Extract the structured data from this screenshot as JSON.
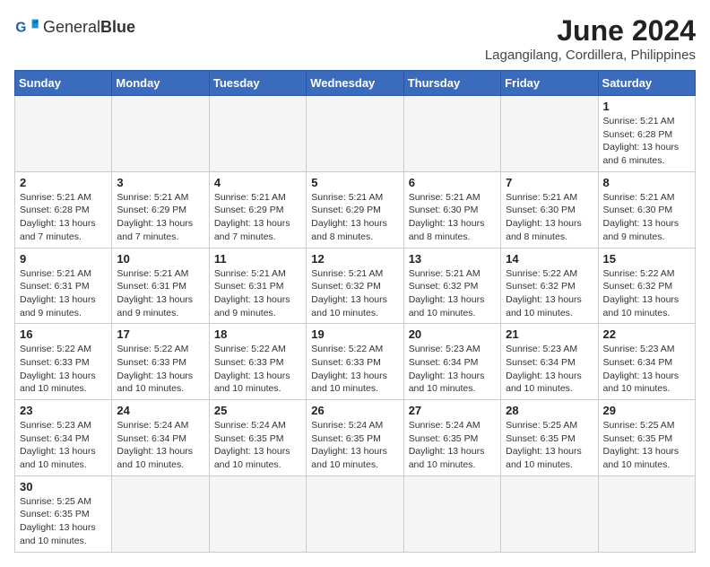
{
  "header": {
    "logo_text_normal": "General",
    "logo_text_bold": "Blue",
    "month_year": "June 2024",
    "location": "Lagangilang, Cordillera, Philippines"
  },
  "weekdays": [
    "Sunday",
    "Monday",
    "Tuesday",
    "Wednesday",
    "Thursday",
    "Friday",
    "Saturday"
  ],
  "weeks": [
    [
      {
        "day": "",
        "info": ""
      },
      {
        "day": "",
        "info": ""
      },
      {
        "day": "",
        "info": ""
      },
      {
        "day": "",
        "info": ""
      },
      {
        "day": "",
        "info": ""
      },
      {
        "day": "",
        "info": ""
      },
      {
        "day": "1",
        "info": "Sunrise: 5:21 AM\nSunset: 6:28 PM\nDaylight: 13 hours and 6 minutes."
      }
    ],
    [
      {
        "day": "2",
        "info": "Sunrise: 5:21 AM\nSunset: 6:28 PM\nDaylight: 13 hours and 7 minutes."
      },
      {
        "day": "3",
        "info": "Sunrise: 5:21 AM\nSunset: 6:29 PM\nDaylight: 13 hours and 7 minutes."
      },
      {
        "day": "4",
        "info": "Sunrise: 5:21 AM\nSunset: 6:29 PM\nDaylight: 13 hours and 7 minutes."
      },
      {
        "day": "5",
        "info": "Sunrise: 5:21 AM\nSunset: 6:29 PM\nDaylight: 13 hours and 8 minutes."
      },
      {
        "day": "6",
        "info": "Sunrise: 5:21 AM\nSunset: 6:30 PM\nDaylight: 13 hours and 8 minutes."
      },
      {
        "day": "7",
        "info": "Sunrise: 5:21 AM\nSunset: 6:30 PM\nDaylight: 13 hours and 8 minutes."
      },
      {
        "day": "8",
        "info": "Sunrise: 5:21 AM\nSunset: 6:30 PM\nDaylight: 13 hours and 9 minutes."
      }
    ],
    [
      {
        "day": "9",
        "info": "Sunrise: 5:21 AM\nSunset: 6:31 PM\nDaylight: 13 hours and 9 minutes."
      },
      {
        "day": "10",
        "info": "Sunrise: 5:21 AM\nSunset: 6:31 PM\nDaylight: 13 hours and 9 minutes."
      },
      {
        "day": "11",
        "info": "Sunrise: 5:21 AM\nSunset: 6:31 PM\nDaylight: 13 hours and 9 minutes."
      },
      {
        "day": "12",
        "info": "Sunrise: 5:21 AM\nSunset: 6:32 PM\nDaylight: 13 hours and 10 minutes."
      },
      {
        "day": "13",
        "info": "Sunrise: 5:21 AM\nSunset: 6:32 PM\nDaylight: 13 hours and 10 minutes."
      },
      {
        "day": "14",
        "info": "Sunrise: 5:22 AM\nSunset: 6:32 PM\nDaylight: 13 hours and 10 minutes."
      },
      {
        "day": "15",
        "info": "Sunrise: 5:22 AM\nSunset: 6:32 PM\nDaylight: 13 hours and 10 minutes."
      }
    ],
    [
      {
        "day": "16",
        "info": "Sunrise: 5:22 AM\nSunset: 6:33 PM\nDaylight: 13 hours and 10 minutes."
      },
      {
        "day": "17",
        "info": "Sunrise: 5:22 AM\nSunset: 6:33 PM\nDaylight: 13 hours and 10 minutes."
      },
      {
        "day": "18",
        "info": "Sunrise: 5:22 AM\nSunset: 6:33 PM\nDaylight: 13 hours and 10 minutes."
      },
      {
        "day": "19",
        "info": "Sunrise: 5:22 AM\nSunset: 6:33 PM\nDaylight: 13 hours and 10 minutes."
      },
      {
        "day": "20",
        "info": "Sunrise: 5:23 AM\nSunset: 6:34 PM\nDaylight: 13 hours and 10 minutes."
      },
      {
        "day": "21",
        "info": "Sunrise: 5:23 AM\nSunset: 6:34 PM\nDaylight: 13 hours and 10 minutes."
      },
      {
        "day": "22",
        "info": "Sunrise: 5:23 AM\nSunset: 6:34 PM\nDaylight: 13 hours and 10 minutes."
      }
    ],
    [
      {
        "day": "23",
        "info": "Sunrise: 5:23 AM\nSunset: 6:34 PM\nDaylight: 13 hours and 10 minutes."
      },
      {
        "day": "24",
        "info": "Sunrise: 5:24 AM\nSunset: 6:34 PM\nDaylight: 13 hours and 10 minutes."
      },
      {
        "day": "25",
        "info": "Sunrise: 5:24 AM\nSunset: 6:35 PM\nDaylight: 13 hours and 10 minutes."
      },
      {
        "day": "26",
        "info": "Sunrise: 5:24 AM\nSunset: 6:35 PM\nDaylight: 13 hours and 10 minutes."
      },
      {
        "day": "27",
        "info": "Sunrise: 5:24 AM\nSunset: 6:35 PM\nDaylight: 13 hours and 10 minutes."
      },
      {
        "day": "28",
        "info": "Sunrise: 5:25 AM\nSunset: 6:35 PM\nDaylight: 13 hours and 10 minutes."
      },
      {
        "day": "29",
        "info": "Sunrise: 5:25 AM\nSunset: 6:35 PM\nDaylight: 13 hours and 10 minutes."
      }
    ],
    [
      {
        "day": "30",
        "info": "Sunrise: 5:25 AM\nSunset: 6:35 PM\nDaylight: 13 hours and 10 minutes."
      },
      {
        "day": "",
        "info": ""
      },
      {
        "day": "",
        "info": ""
      },
      {
        "day": "",
        "info": ""
      },
      {
        "day": "",
        "info": ""
      },
      {
        "day": "",
        "info": ""
      },
      {
        "day": "",
        "info": ""
      }
    ]
  ]
}
